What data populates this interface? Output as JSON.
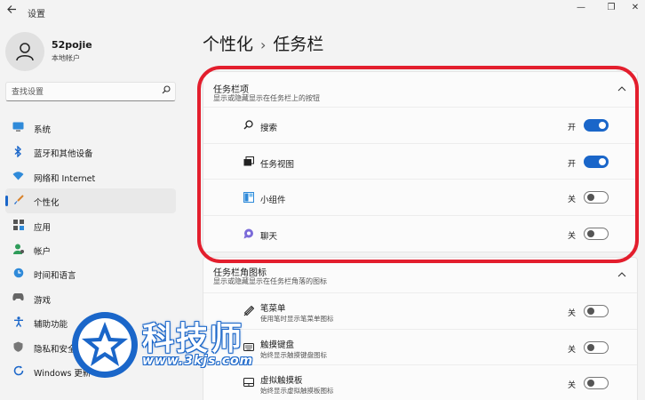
{
  "window": {
    "title": "设置",
    "back_icon": "arrow-left-icon",
    "min_glyph": "—",
    "max_glyph": "❐",
    "close_glyph": "✕"
  },
  "user": {
    "name": "52pojie",
    "account_type": "本地帐户"
  },
  "search": {
    "placeholder": "查找设置"
  },
  "sidebar": {
    "items": [
      {
        "label": "系统",
        "icon": "monitor-icon",
        "active": false
      },
      {
        "label": "蓝牙和其他设备",
        "icon": "bluetooth-icon",
        "active": false
      },
      {
        "label": "网络和 Internet",
        "icon": "wifi-icon",
        "active": false
      },
      {
        "label": "个性化",
        "icon": "brush-icon",
        "active": true
      },
      {
        "label": "应用",
        "icon": "apps-icon",
        "active": false
      },
      {
        "label": "帐户",
        "icon": "account-icon",
        "active": false
      },
      {
        "label": "时间和语言",
        "icon": "globe-clock-icon",
        "active": false
      },
      {
        "label": "游戏",
        "icon": "gamepad-icon",
        "active": false
      },
      {
        "label": "辅助功能",
        "icon": "accessibility-icon",
        "active": false
      },
      {
        "label": "隐私和安全性",
        "icon": "shield-icon",
        "active": false
      },
      {
        "label": "Windows 更新",
        "icon": "update-icon",
        "active": false
      }
    ]
  },
  "breadcrumb": {
    "parent": "个性化",
    "separator": "›",
    "current": "任务栏"
  },
  "taskbar_items": {
    "title": "任务栏项",
    "subtitle": "显示或隐藏显示在任务栏上的按钮",
    "rows": [
      {
        "label": "搜索",
        "state": "开",
        "on": true,
        "icon": "search-icon"
      },
      {
        "label": "任务视图",
        "state": "开",
        "on": true,
        "icon": "task-view-icon"
      },
      {
        "label": "小组件",
        "state": "关",
        "on": false,
        "icon": "widgets-icon"
      },
      {
        "label": "聊天",
        "state": "关",
        "on": false,
        "icon": "chat-icon"
      }
    ]
  },
  "corner_icons": {
    "title": "任务栏角图标",
    "subtitle": "显示或隐藏显示在任务栏角落的图标",
    "rows": [
      {
        "label": "笔菜单",
        "desc": "使用笔时显示笔菜单图标",
        "state": "关",
        "on": false,
        "icon": "pen-icon"
      },
      {
        "label": "触摸键盘",
        "desc": "始终显示触摸键盘图标",
        "state": "关",
        "on": false,
        "icon": "keyboard-icon"
      },
      {
        "label": "虚拟触摸板",
        "desc": "始终显示虚拟触摸板图标",
        "state": "关",
        "on": false,
        "icon": "touchpad-icon"
      }
    ]
  },
  "watermark": {
    "text": "科技师",
    "url": "www.3kjs.com"
  },
  "colors": {
    "accent": "#1a66c9",
    "highlight_outline": "#e31e2d"
  }
}
